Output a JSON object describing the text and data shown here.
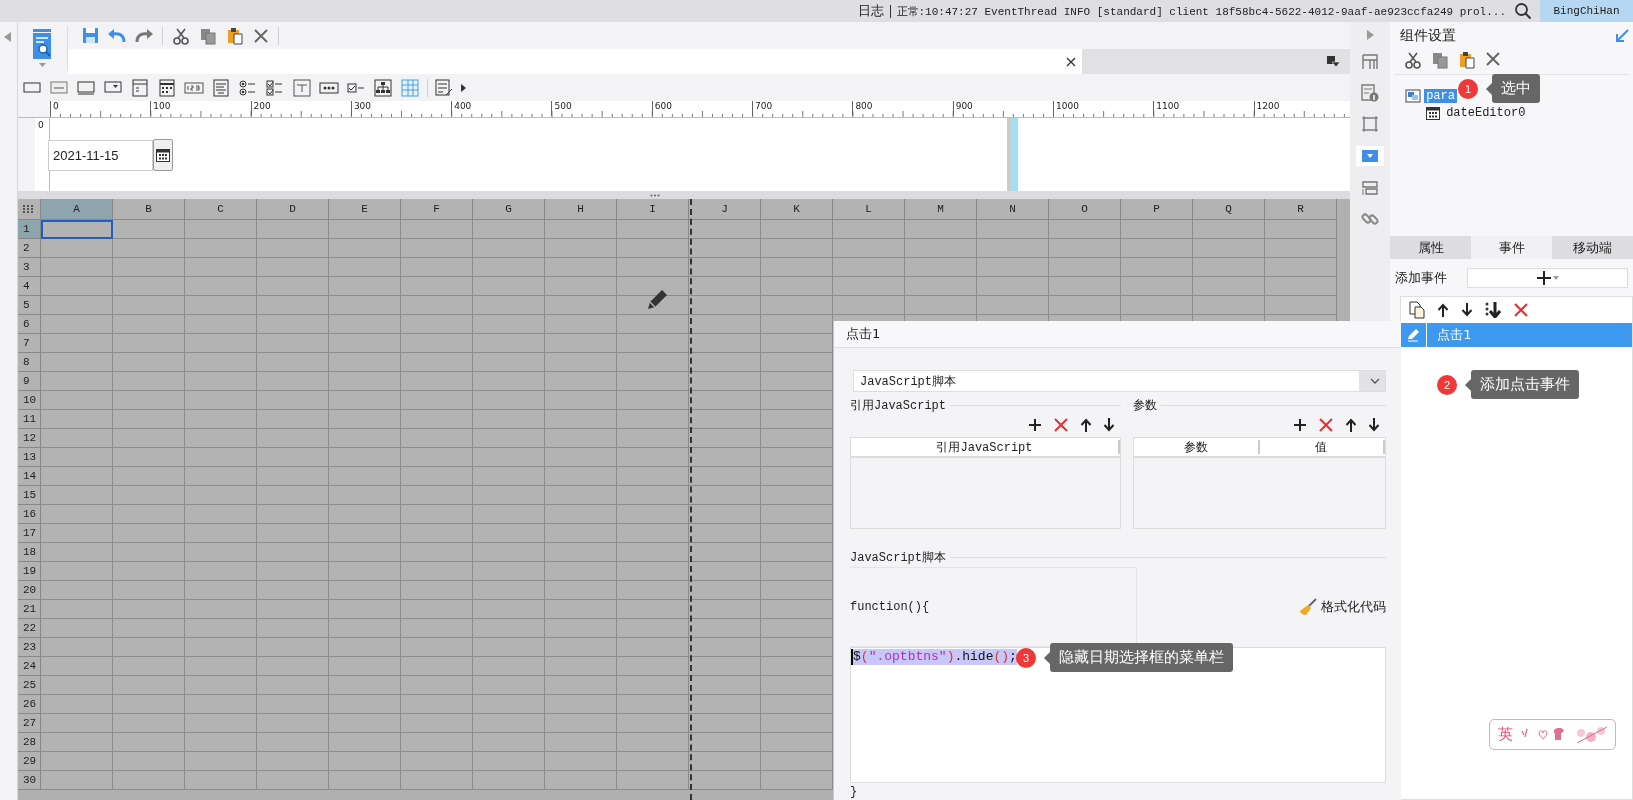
{
  "top_bar": {
    "log_label": "日志",
    "status": "正常:10:47:27 EventThread INFO [standard] client 18f58bc4-5622-4012-9aaf-ae923ccfa249 prol...",
    "user": "BingChiHan"
  },
  "ruler": {
    "ticks": [
      "0",
      "100",
      "200",
      "300",
      "400",
      "500",
      "600",
      "700",
      "800",
      "900",
      "1000",
      "1100",
      "1200"
    ],
    "side_tick": "0"
  },
  "canvas": {
    "date_value": "2021-11-15"
  },
  "sheet": {
    "columns": [
      {
        "label": "A",
        "selected": true
      },
      {
        "label": "B",
        "selected": false
      },
      {
        "label": "C",
        "selected": false
      },
      {
        "label": "D",
        "selected": false
      },
      {
        "label": "E",
        "selected": false
      },
      {
        "label": "F",
        "selected": false
      },
      {
        "label": "G",
        "selected": false
      },
      {
        "label": "H",
        "selected": false
      },
      {
        "label": "I",
        "selected": false
      },
      {
        "label": "J",
        "selected": false
      },
      {
        "label": "K",
        "selected": false
      },
      {
        "label": "L",
        "selected": false
      },
      {
        "label": "M",
        "selected": false
      },
      {
        "label": "N",
        "selected": false
      },
      {
        "label": "O",
        "selected": false
      },
      {
        "label": "P",
        "selected": false
      },
      {
        "label": "Q",
        "selected": false
      },
      {
        "label": "R",
        "selected": false
      }
    ],
    "rows": [
      {
        "label": "1",
        "selected": true
      },
      {
        "label": "2",
        "selected": false
      },
      {
        "label": "3",
        "selected": false
      },
      {
        "label": "4",
        "selected": false
      },
      {
        "label": "5",
        "selected": false
      },
      {
        "label": "6",
        "selected": false
      },
      {
        "label": "7",
        "selected": false
      },
      {
        "label": "8",
        "selected": false
      },
      {
        "label": "9",
        "selected": false
      },
      {
        "label": "10",
        "selected": false
      },
      {
        "label": "11",
        "selected": false
      },
      {
        "label": "12",
        "selected": false
      },
      {
        "label": "13",
        "selected": false
      },
      {
        "label": "14",
        "selected": false
      },
      {
        "label": "15",
        "selected": false
      },
      {
        "label": "16",
        "selected": false
      },
      {
        "label": "17",
        "selected": false
      },
      {
        "label": "18",
        "selected": false
      },
      {
        "label": "19",
        "selected": false
      },
      {
        "label": "20",
        "selected": false
      },
      {
        "label": "21",
        "selected": false
      },
      {
        "label": "22",
        "selected": false
      },
      {
        "label": "23",
        "selected": false
      },
      {
        "label": "24",
        "selected": false
      },
      {
        "label": "25",
        "selected": false
      },
      {
        "label": "26",
        "selected": false
      },
      {
        "label": "27",
        "selected": false
      },
      {
        "label": "28",
        "selected": false
      },
      {
        "label": "29",
        "selected": false
      },
      {
        "label": "30",
        "selected": false
      }
    ]
  },
  "event_dialog": {
    "title": "点击1",
    "type_select": "JavaScript脚本",
    "ref_section": {
      "title": "引用JavaScript",
      "columns": [
        "引用JavaScript"
      ]
    },
    "param_section": {
      "title": "参数",
      "columns": [
        "参数",
        "值"
      ]
    },
    "script_section": {
      "title": "JavaScript脚本",
      "header": "function(){",
      "format_button": "格式化代码",
      "code": {
        "selected": true,
        "tokens": [
          {
            "text": "$",
            "kind": "plain"
          },
          {
            "text": "(",
            "kind": "paren"
          },
          {
            "text": "\".optbtns\"",
            "kind": "string"
          },
          {
            "text": ")",
            "kind": "paren"
          },
          {
            "text": ".hide",
            "kind": "plain"
          },
          {
            "text": "()",
            "kind": "paren"
          },
          {
            "text": ";",
            "kind": "plain"
          }
        ]
      },
      "footer": "}"
    }
  },
  "right_panel": {
    "title": "组件设置",
    "tree": [
      {
        "label": "para",
        "selected": true,
        "children": [
          {
            "label": "dateEditor0",
            "selected": false
          }
        ]
      }
    ],
    "tabs": [
      {
        "label": "属性",
        "selected": false
      },
      {
        "label": "事件",
        "selected": true
      },
      {
        "label": "移动端",
        "selected": false
      }
    ],
    "add_event_label": "添加事件",
    "events": [
      {
        "label": "点击1",
        "selected": true
      }
    ]
  },
  "annotations": [
    {
      "number": "1",
      "text": "选中"
    },
    {
      "number": "2",
      "text": "添加点击事件"
    },
    {
      "number": "3",
      "text": "隐藏日期选择框的菜单栏"
    }
  ],
  "ime": {
    "mode": "英"
  }
}
